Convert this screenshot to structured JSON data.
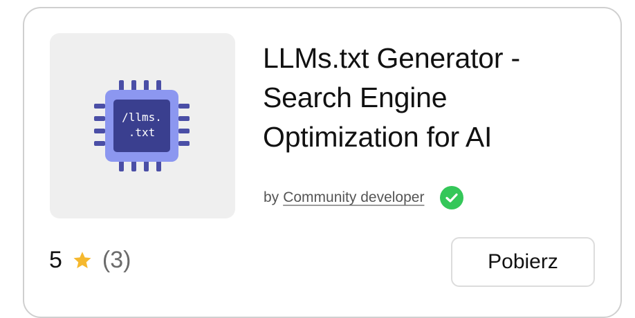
{
  "extension": {
    "title": "LLMs.txt Generator - Search Engine Optimization for AI",
    "by_label": "by",
    "developer": "Community developer",
    "verified_icon": "check-circle-icon",
    "icon_text_line1": "/llms.",
    "icon_text_line2": ".txt"
  },
  "rating": {
    "score": "5",
    "star_icon": "star-icon",
    "count": "(3)"
  },
  "actions": {
    "install_label": "Pobierz"
  },
  "colors": {
    "chip_body": "#8c97f0",
    "chip_core": "#3a3f8f",
    "chip_pins": "#4a4ea6",
    "verified": "#34c759",
    "star": "#f5b82e",
    "thumbnail_bg": "#efefef"
  }
}
